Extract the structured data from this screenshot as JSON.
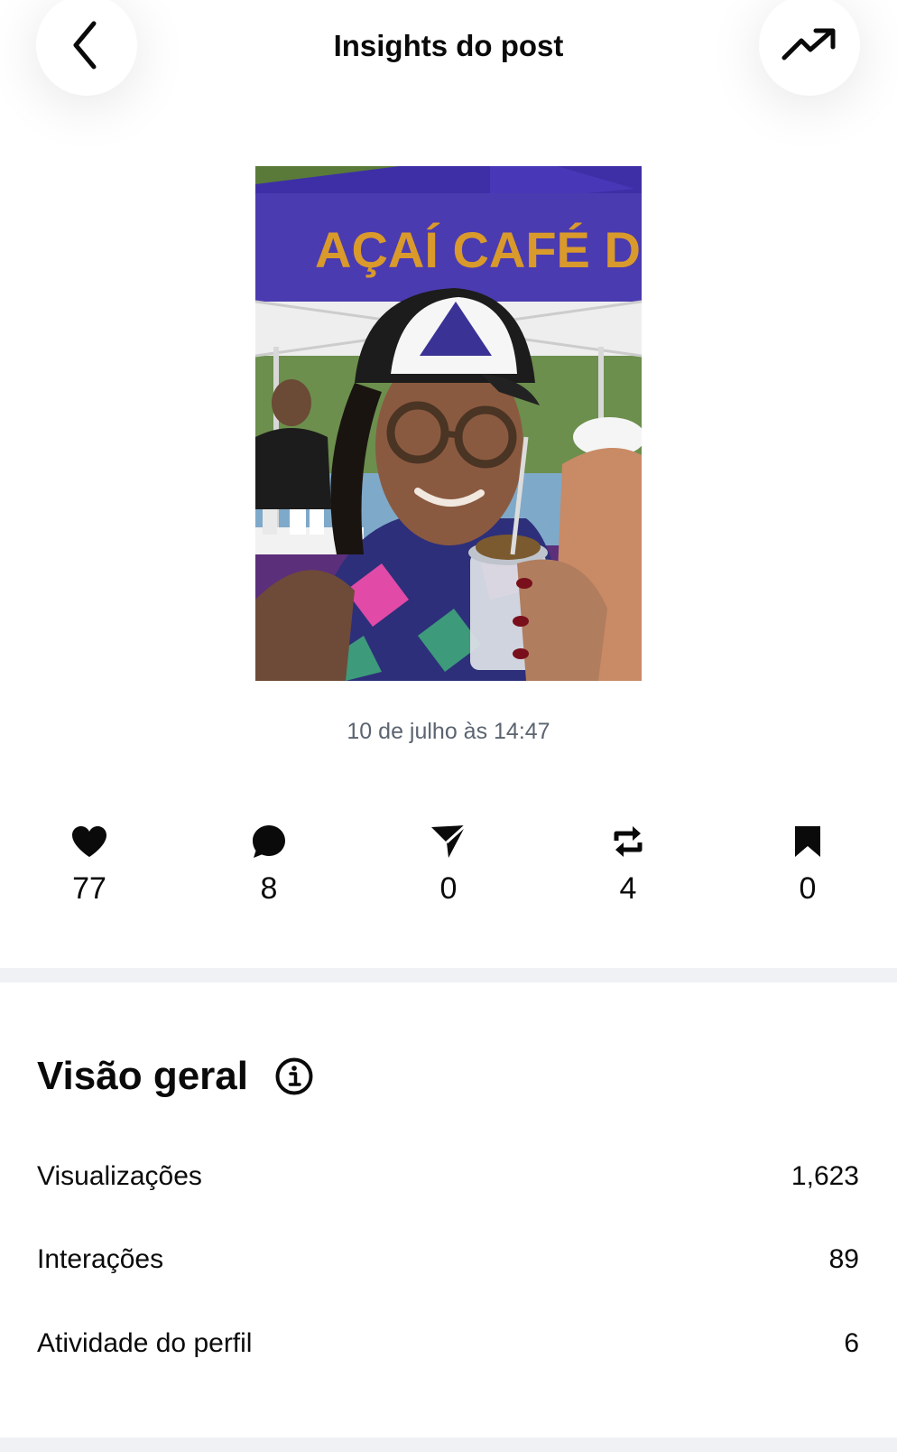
{
  "header": {
    "title": "Insights do post",
    "back_icon": "chevron-left-icon",
    "trend_icon": "trending-up-icon"
  },
  "post": {
    "banner_text": "AÇAÍ CAFÉ D",
    "date": "10 de julho às 14:47"
  },
  "stats": [
    {
      "icon": "heart-icon",
      "value": "77"
    },
    {
      "icon": "comment-icon",
      "value": "8"
    },
    {
      "icon": "send-icon",
      "value": "0"
    },
    {
      "icon": "repost-icon",
      "value": "4"
    },
    {
      "icon": "bookmark-icon",
      "value": "0"
    }
  ],
  "overview": {
    "title": "Visão geral",
    "info_icon": "info-icon",
    "rows": [
      {
        "label": "Visualizações",
        "value": "1,623"
      },
      {
        "label": "Interações",
        "value": "89"
      },
      {
        "label": "Atividade do perfil",
        "value": "6"
      }
    ]
  },
  "colors": {
    "text": "#0a0a0a",
    "muted": "#5b6470",
    "divider": "#eff1f5",
    "tent_purple": "#4b3bb0",
    "tent_text": "#d99a2b"
  }
}
